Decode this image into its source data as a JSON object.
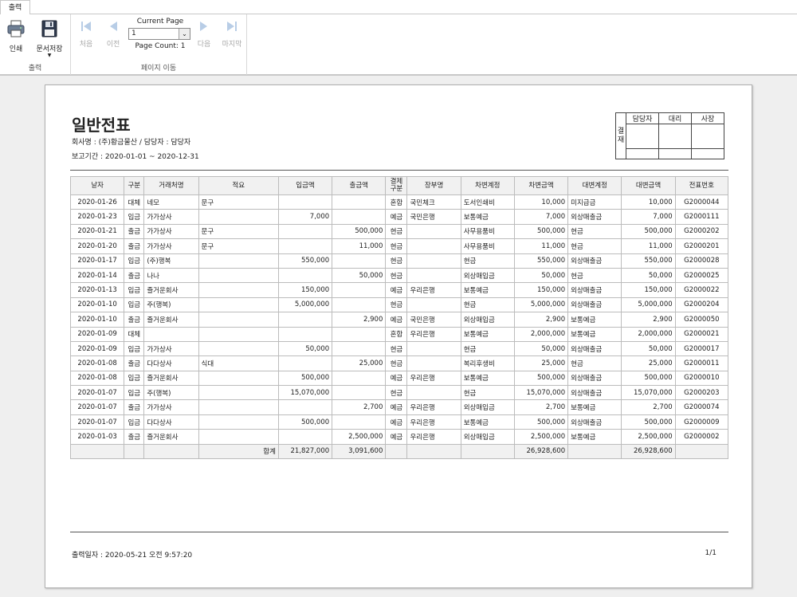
{
  "tab": {
    "label": "출력"
  },
  "ribbon": {
    "print_label": "인쇄",
    "save_label": "문서저장",
    "output_group_label": "출력",
    "current_page_label": "Current Page",
    "current_page_value": "1",
    "page_count_text": "Page Count: 1",
    "nav": {
      "first": "처음",
      "prev": "이전",
      "next": "다음",
      "last": "마지막"
    },
    "nav_group_label": "페이지 이동"
  },
  "report": {
    "title": "일반전표",
    "company_line": "회사명 : (주)황금물산 / 담당자 : 담당자",
    "period_line": "보고기간 : 2020-01-01 ~ 2020-12-31",
    "approval": {
      "side": "결재",
      "cols": [
        "담당자",
        "대리",
        "사장"
      ]
    },
    "columns": [
      "날자",
      "구분",
      "거래처명",
      "적요",
      "입금액",
      "출금액",
      "결제구분",
      "장부명",
      "차변계정",
      "차변금액",
      "대변계정",
      "대변금액",
      "전표번호"
    ],
    "rows": [
      [
        "2020-01-26",
        "대체",
        "네모",
        "문구",
        "",
        "",
        "혼합",
        "국민체크",
        "도서인쇄비",
        "10,000",
        "미지급금",
        "10,000",
        "G2000044"
      ],
      [
        "2020-01-23",
        "입금",
        "가가상사",
        "",
        "7,000",
        "",
        "예금",
        "국민은행",
        "보통예금",
        "7,000",
        "외상매출금",
        "7,000",
        "G2000111"
      ],
      [
        "2020-01-21",
        "출금",
        "가가상사",
        "문구",
        "",
        "500,000",
        "현금",
        "",
        "사무용품비",
        "500,000",
        "현금",
        "500,000",
        "G2000202"
      ],
      [
        "2020-01-20",
        "출금",
        "가가상사",
        "문구",
        "",
        "11,000",
        "현금",
        "",
        "사무용품비",
        "11,000",
        "현금",
        "11,000",
        "G2000201"
      ],
      [
        "2020-01-17",
        "입금",
        "(주)행복",
        "",
        "550,000",
        "",
        "현금",
        "",
        "현금",
        "550,000",
        "외상매출금",
        "550,000",
        "G2000028"
      ],
      [
        "2020-01-14",
        "출금",
        "나나",
        "",
        "",
        "50,000",
        "현금",
        "",
        "외상매입금",
        "50,000",
        "현금",
        "50,000",
        "G2000025"
      ],
      [
        "2020-01-13",
        "입금",
        "즐거운회사",
        "",
        "150,000",
        "",
        "예금",
        "우리은행",
        "보통예금",
        "150,000",
        "외상매출금",
        "150,000",
        "G2000022"
      ],
      [
        "2020-01-10",
        "입금",
        "주(행복)",
        "",
        "5,000,000",
        "",
        "현금",
        "",
        "현금",
        "5,000,000",
        "외상매출금",
        "5,000,000",
        "G2000204"
      ],
      [
        "2020-01-10",
        "출금",
        "즐거운회사",
        "",
        "",
        "2,900",
        "예금",
        "국민은행",
        "외상매입금",
        "2,900",
        "보통예금",
        "2,900",
        "G2000050"
      ],
      [
        "2020-01-09",
        "대체",
        "",
        "",
        "",
        "",
        "혼합",
        "우리은행",
        "보통예금",
        "2,000,000",
        "보통예금",
        "2,000,000",
        "G2000021"
      ],
      [
        "2020-01-09",
        "입금",
        "가가상사",
        "",
        "50,000",
        "",
        "현금",
        "",
        "현금",
        "50,000",
        "외상매출금",
        "50,000",
        "G2000017"
      ],
      [
        "2020-01-08",
        "출금",
        "다다상사",
        "식대",
        "",
        "25,000",
        "현금",
        "",
        "복리후생비",
        "25,000",
        "현금",
        "25,000",
        "G2000011"
      ],
      [
        "2020-01-08",
        "입금",
        "즐거운회사",
        "",
        "500,000",
        "",
        "예금",
        "우리은행",
        "보통예금",
        "500,000",
        "외상매출금",
        "500,000",
        "G2000010"
      ],
      [
        "2020-01-07",
        "입금",
        "주(행복)",
        "",
        "15,070,000",
        "",
        "현금",
        "",
        "현금",
        "15,070,000",
        "외상매출금",
        "15,070,000",
        "G2000203"
      ],
      [
        "2020-01-07",
        "출금",
        "가가상사",
        "",
        "",
        "2,700",
        "예금",
        "우리은행",
        "외상매입금",
        "2,700",
        "보통예금",
        "2,700",
        "G2000074"
      ],
      [
        "2020-01-07",
        "입금",
        "다다상사",
        "",
        "500,000",
        "",
        "예금",
        "우리은행",
        "보통예금",
        "500,000",
        "외상매출금",
        "500,000",
        "G2000009"
      ],
      [
        "2020-01-03",
        "출금",
        "즐거운회사",
        "",
        "",
        "2,500,000",
        "예금",
        "우리은행",
        "외상매입금",
        "2,500,000",
        "보통예금",
        "2,500,000",
        "G2000002"
      ]
    ],
    "total": {
      "label": "합계",
      "deposit": "21,827,000",
      "withdraw": "3,091,600",
      "debit": "26,928,600",
      "credit": "26,928,600"
    },
    "footer": {
      "print_date": "출력일자 : 2020-05-21 오전 9:57:20",
      "page": "1/1"
    }
  }
}
